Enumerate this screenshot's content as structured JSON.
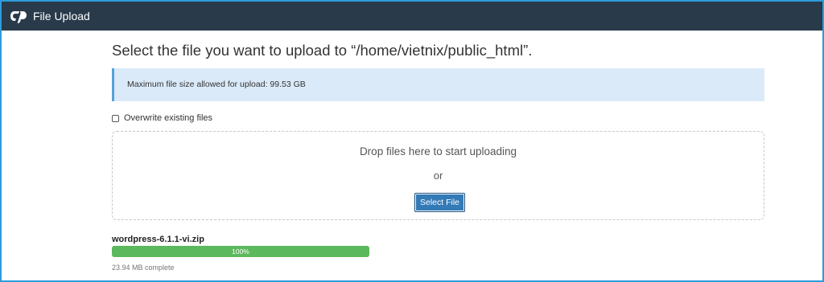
{
  "titlebar": {
    "logo_icon": "cpanel-logo-icon",
    "title": "File Upload"
  },
  "main": {
    "heading": "Select the file you want to upload to “/home/vietnix/public_html”.",
    "info": "Maximum file size allowed for upload: 99.53 GB",
    "overwrite": {
      "label": "Overwrite existing files",
      "checked": false
    },
    "dropzone": {
      "prompt": "Drop files here to start uploading",
      "or": "or",
      "button_label": "Select File"
    }
  },
  "upload": {
    "file_name": "wordpress-6.1.1-vi.zip",
    "progress_fraction": 1.0,
    "progress_label": "100%",
    "status": "23.94 MB complete"
  },
  "colors": {
    "titlebar_bg": "#293a4a",
    "info_bg": "#daeaf8",
    "button_bg": "#337ab7",
    "progress_fill": "#5cb85c",
    "frame_border": "#2d9cdb"
  }
}
